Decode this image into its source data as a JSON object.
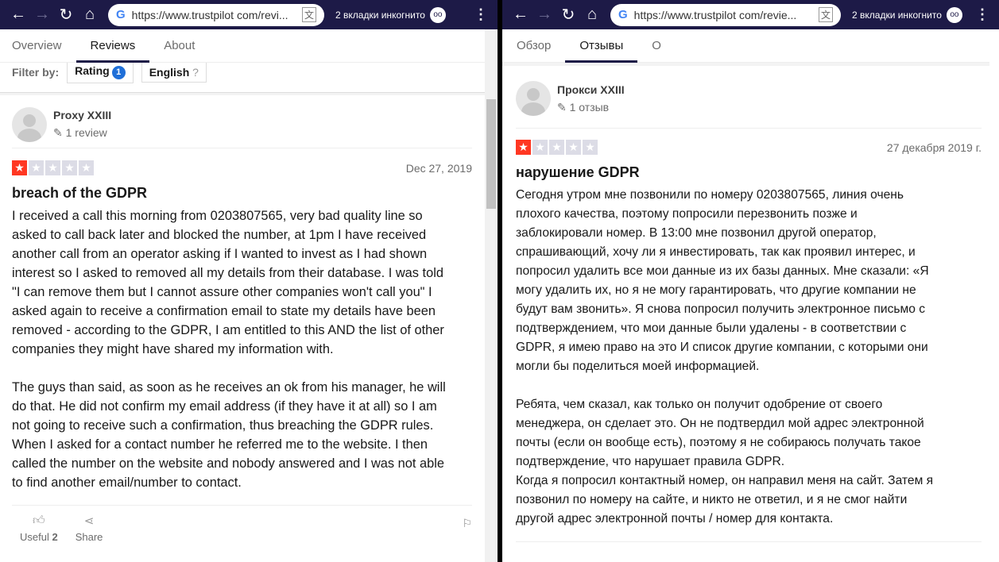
{
  "browser": {
    "url_left": "https://www.trustpilot com/revi...",
    "url_right": "https://www.trustpilot com/revie...",
    "incognito": "2 вкладки инкогнито"
  },
  "left": {
    "tabs": [
      "Overview",
      "Reviews",
      "About"
    ],
    "filter": {
      "label": "Filter by:",
      "rating": "Rating",
      "rating_count": "1",
      "language": "English"
    },
    "review": {
      "user": "Proxy XXIII",
      "count": "1 review",
      "rating": 1,
      "date": "Dec 27, 2019",
      "title": "breach of the GDPR",
      "lines": [
        "I received a call this morning from 0203807565, very bad quality line so",
        "asked to call back later and blocked the number, at 1pm I have received",
        "another call from an operator asking if I wanted to invest as I had shown",
        "interest so I asked to removed all my details from their database. I was told",
        "\"I can remove them but I cannot assure other companies won't call you\" I",
        "asked again to receive a confirmation email to state my details have been",
        "removed - according to the GDPR, I am entitled to this AND the list of other",
        "companies they might have shared my information with.",
        "",
        "The guys than said, as soon as he receives an ok from his manager, he will",
        "do that. He did not confirm my email address (if they have it at all) so I am",
        "not going to receive such a confirmation, thus breaching the GDPR rules.",
        "When I asked for a contact number he referred me to the website. I then",
        "called the number on the website and nobody answered and I was not able",
        "to find another email/number to contact."
      ],
      "useful": "Useful",
      "useful_count": "2",
      "share": "Share"
    }
  },
  "right": {
    "tabs": [
      "Обзор",
      "Отзывы",
      "О"
    ],
    "review": {
      "user": "Прокси XXIII",
      "count": "1 отзыв",
      "rating": 1,
      "date": "27 декабря 2019 г.",
      "title": "нарушение GDPR",
      "lines": [
        "Сегодня утром мне позвонили по номеру 0203807565, линия очень",
        "плохого качества, поэтому попросили перезвонить позже и",
        "заблокировали номер. В 13:00 мне позвонил другой оператор,",
        "спрашивающий, хочу ли я инвестировать, так как проявил интерес, и",
        "попросил удалить все мои данные из их базы данных. Мне сказали: «Я",
        "могу удалить их, но я не могу гарантировать, что другие компании не",
        "будут вам звонить». Я снова попросил получить электронное письмо с",
        "подтверждением, что мои данные были удалены - в соответствии с",
        "GDPR, я имею право на это И список другие компании, с которыми они",
        "могли бы поделиться моей информацией.",
        "",
        "Ребята, чем сказал, как только он получит одобрение от своего",
        "менеджера, он сделает это. Он не подтвердил мой адрес электронной",
        "почты (если он вообще есть), поэтому я не собираюсь получать такое",
        "подтверждение, что нарушает правила GDPR.",
        "Когда я попросил контактный номер, он направил меня на сайт. Затем я",
        "позвонил по номеру на сайте, и никто не ответил, и я не смог найти",
        "другой адрес электронной почты / номер для контакта."
      ]
    }
  }
}
